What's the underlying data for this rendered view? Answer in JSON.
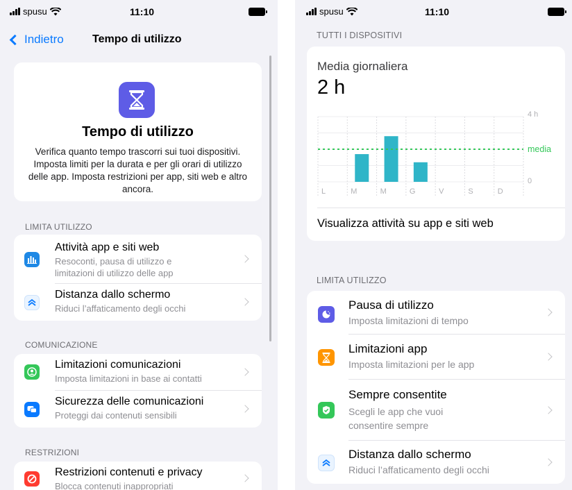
{
  "left": {
    "status": {
      "carrier": "spusu",
      "time": "11:10"
    },
    "nav": {
      "back_label": "Indietro",
      "title": "Tempo di utilizzo"
    },
    "hero": {
      "title": "Tempo di utilizzo",
      "body": "Verifica quanto tempo trascorri sui tuoi dispositivi. Imposta limiti per la durata e per gli orari di utilizzo delle app. Imposta restrizioni per app, siti web e altro ancora."
    },
    "sections": {
      "limita": "LIMITA UTILIZZO",
      "comunicazione": "COMUNICAZIONE",
      "restrizioni": "RESTRIZIONI"
    },
    "rows": {
      "attivita": {
        "title": "Attività app e siti web",
        "sub1": "Resoconti, pausa di utilizzo e",
        "sub2": "limitazioni di utilizzo delle app"
      },
      "distanza": {
        "title": "Distanza dallo schermo",
        "sub1": "Riduci l’affaticamento degli occhi"
      },
      "comunicazioni": {
        "title": "Limitazioni comunicazioni",
        "sub1": "Imposta limitazioni in base ai contatti"
      },
      "sicurezza": {
        "title": "Sicurezza delle comunicazioni",
        "sub1": "Proteggi dai contenuti sensibili"
      },
      "contenuti": {
        "title": "Restrizioni contenuti e privacy",
        "sub1": "Blocca contenuti inappropriati"
      }
    }
  },
  "right": {
    "status": {
      "carrier": "spusu",
      "time": "11:10"
    },
    "section_devices": "TUTTI I DISPOSITIVI",
    "daily": {
      "label": "Media giornaliera",
      "value": "2 h"
    },
    "activity_link": "Visualizza attività su app e siti web",
    "section_limita": "LIMITA UTILIZZO",
    "rows": {
      "pausa": {
        "title": "Pausa di utilizzo",
        "sub1": "Imposta limitazioni di tempo"
      },
      "limitazioni": {
        "title": "Limitazioni app",
        "sub1": "Imposta limitazioni per le app"
      },
      "sempre": {
        "title": "Sempre consentite",
        "sub1": "Scegli le app che vuoi",
        "sub2": "consentire sempre"
      },
      "distanza": {
        "title": "Distanza dallo schermo",
        "sub1": "Riduci l’affaticamento degli occhi"
      }
    }
  },
  "chart_data": {
    "type": "bar",
    "categories": [
      "L",
      "M",
      "M",
      "G",
      "V",
      "S",
      "D"
    ],
    "values": [
      0,
      1.7,
      2.8,
      1.2,
      0,
      0,
      0
    ],
    "ylim": [
      0,
      4
    ],
    "y_tick_labels": [
      "4 h",
      "0"
    ],
    "average": 2,
    "average_label": "media",
    "grid": true,
    "colors": {
      "bar": "#2fb5c8",
      "average": "#34c759"
    }
  },
  "colors": {
    "accent": "#0a7aff",
    "icon_blue": "#1e88e5",
    "icon_purple": "#5e5ce6",
    "icon_orange": "#ff9500",
    "icon_green": "#34c759",
    "icon_red": "#ff3b30"
  }
}
